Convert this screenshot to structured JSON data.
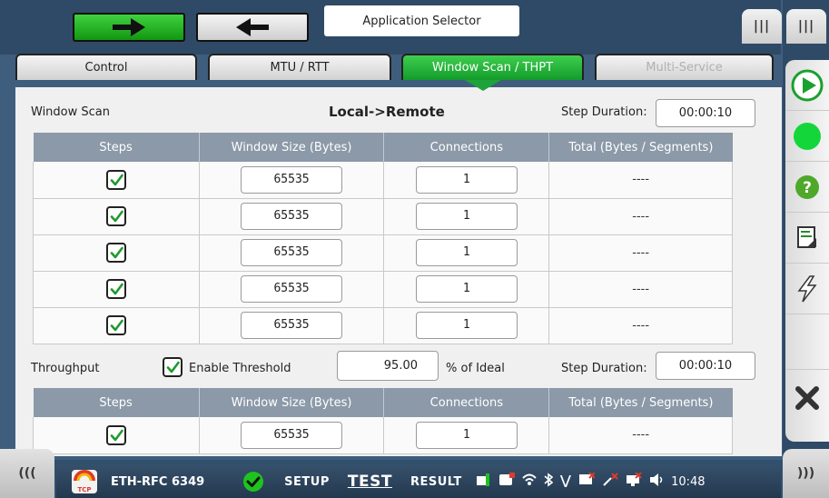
{
  "top": {
    "app_selector": "Application Selector",
    "right_tab_1": "|||",
    "right_tab_2": "|||"
  },
  "tabs": [
    {
      "label": "Control"
    },
    {
      "label": "MTU / RTT"
    },
    {
      "label": "Window Scan / THPT"
    },
    {
      "label": "Multi-Service"
    }
  ],
  "window_scan": {
    "label": "Window Scan",
    "direction": "Local->Remote",
    "step_duration_label": "Step Duration:",
    "step_duration": "00:00:10",
    "headers": [
      "Steps",
      "Window Size (Bytes)",
      "Connections",
      "Total (Bytes / Segments)"
    ],
    "rows": [
      {
        "checked": true,
        "window_size": "65535",
        "connections": "1",
        "total": "----"
      },
      {
        "checked": true,
        "window_size": "65535",
        "connections": "1",
        "total": "----"
      },
      {
        "checked": true,
        "window_size": "65535",
        "connections": "1",
        "total": "----"
      },
      {
        "checked": true,
        "window_size": "65535",
        "connections": "1",
        "total": "----"
      },
      {
        "checked": true,
        "window_size": "65535",
        "connections": "1",
        "total": "----"
      }
    ]
  },
  "throughput": {
    "label": "Throughput",
    "enable_threshold_label": "Enable Threshold",
    "threshold": "95.00",
    "threshold_unit": "% of Ideal",
    "step_duration_label": "Step Duration:",
    "step_duration": "00:00:10",
    "headers": [
      "Steps",
      "Window Size (Bytes)",
      "Connections",
      "Total (Bytes / Segments)"
    ],
    "rows": [
      {
        "checked": true,
        "window_size": "65535",
        "connections": "1",
        "total": "----"
      }
    ]
  },
  "status_bar": {
    "test_name": "ETH-RFC 6349",
    "logo_text": "TCP",
    "modes": [
      "SETUP",
      "TEST",
      "RESULT"
    ],
    "active_mode": "TEST",
    "status_v": "V",
    "time": "10:48"
  },
  "side_nav": {
    "left": "(((",
    "right": ")))"
  },
  "colors": {
    "accent_green": "#1ea33a",
    "header_gray": "#8b99a8",
    "frame": "#2f4a66"
  }
}
